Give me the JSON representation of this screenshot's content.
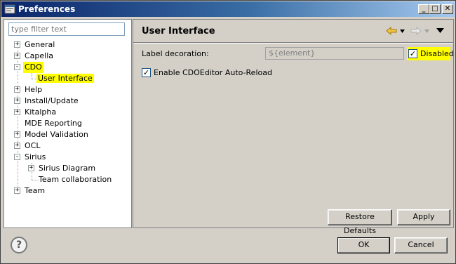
{
  "window": {
    "title": "Preferences"
  },
  "filter": {
    "placeholder": "type filter text"
  },
  "tree": {
    "items": [
      {
        "label": "General",
        "exp": "+"
      },
      {
        "label": "Capella",
        "exp": "+"
      },
      {
        "label": "CDO",
        "exp": "-"
      },
      {
        "label": "User Interface"
      },
      {
        "label": "Help",
        "exp": "+"
      },
      {
        "label": "Install/Update",
        "exp": "+"
      },
      {
        "label": "Kitalpha",
        "exp": "+"
      },
      {
        "label": "MDE Reporting"
      },
      {
        "label": "Model Validation",
        "exp": "+"
      },
      {
        "label": "OCL",
        "exp": "+"
      },
      {
        "label": "Sirius",
        "exp": "-"
      },
      {
        "label": "Sirius Diagram",
        "exp": "+"
      },
      {
        "label": "Team collaboration"
      },
      {
        "label": "Team",
        "exp": "+"
      }
    ]
  },
  "page": {
    "title": "User Interface",
    "label_decoration": "Label decoration:",
    "decoration_value": "${element}",
    "disabled_label": "Disabled",
    "disabled_checked": "✓",
    "auto_reload_label": "Enable CDOEditor Auto-Reload",
    "auto_reload_checked": "✓",
    "restore_defaults": "Restore Defaults",
    "apply": "Apply"
  },
  "footer": {
    "ok": "OK",
    "cancel": "Cancel",
    "help": "?"
  },
  "titlebar_buttons": {
    "minimize": "_",
    "maximize": "□",
    "close": "✕"
  },
  "colors": {
    "highlight": "#ffff00",
    "title_start": "#0a246a",
    "title_end": "#a6caf0"
  }
}
